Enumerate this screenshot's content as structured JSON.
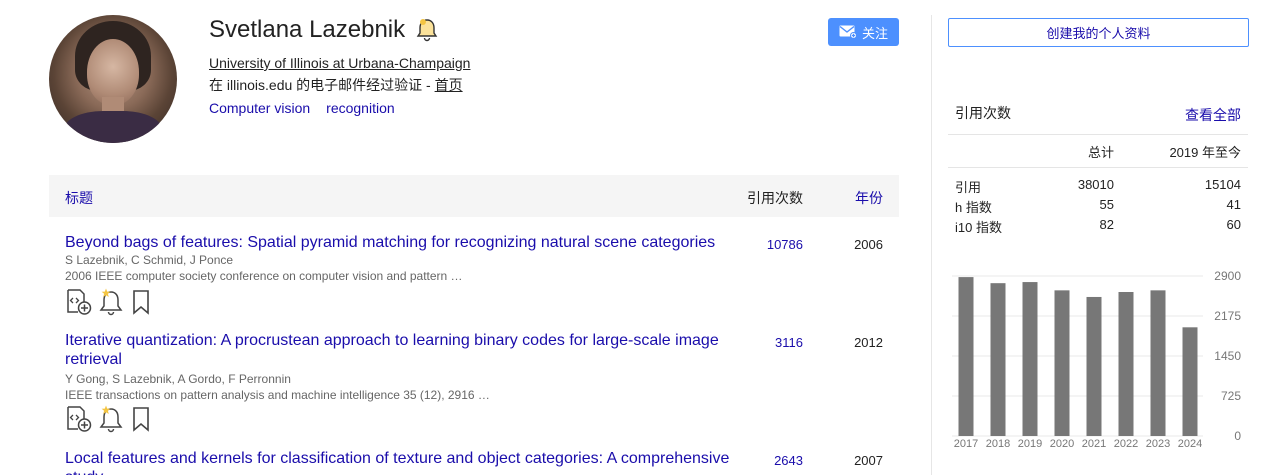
{
  "profile": {
    "name": "Svetlana Lazebnik",
    "affiliation": "University of Illinois at Urbana-Champaign",
    "verified_prefix": "在 illinois.edu 的电子邮件经过验证 - ",
    "homepage_label": "首页",
    "interests": [
      "Computer vision",
      "recognition"
    ],
    "follow_label": "关注"
  },
  "table": {
    "header_title": "标题",
    "header_cites": "引用次数",
    "header_year": "年份",
    "rows": [
      {
        "title": "Beyond bags of features: Spatial pyramid matching for recognizing natural scene categories",
        "authors": "S Lazebnik, C Schmid, J Ponce",
        "venue": "2006 IEEE computer society conference on computer vision and pattern …",
        "cites": "10786",
        "year": "2006"
      },
      {
        "title": "Iterative quantization: A procrustean approach to learning binary codes for large-scale image retrieval",
        "authors": "Y Gong, S Lazebnik, A Gordo, F Perronnin",
        "venue": "IEEE transactions on pattern analysis and machine intelligence 35 (12), 2916 …",
        "cites": "3116",
        "year": "2012"
      },
      {
        "title": "Local features and kernels for classification of texture and object categories: A comprehensive study",
        "cites": "2643",
        "year": "2007"
      }
    ]
  },
  "sidebar": {
    "create_profile_label": "创建我的个人资料",
    "stats_title": "引用次数",
    "view_all_label": "查看全部",
    "col_total": "总计",
    "col_since": "2019 年至今",
    "stats": [
      {
        "label": "引用",
        "total": "38010",
        "since": "15104"
      },
      {
        "label": "h 指数",
        "total": "55",
        "since": "41"
      },
      {
        "label": "i10 指数",
        "total": "82",
        "since": "60"
      }
    ]
  },
  "chart_data": {
    "type": "bar",
    "categories": [
      "2017",
      "2018",
      "2019",
      "2020",
      "2021",
      "2022",
      "2023",
      "2024"
    ],
    "values": [
      2880,
      2770,
      2790,
      2640,
      2520,
      2610,
      2640,
      1970
    ],
    "yticks": [
      "2900",
      "2175",
      "1450",
      "725",
      "0"
    ],
    "ylim": [
      0,
      2900
    ],
    "bar_color": "#777777",
    "grid": true
  },
  "colors": {
    "link": "#1a0dab",
    "button_blue": "#4d90fe",
    "header_bg": "#f5f5f5"
  }
}
